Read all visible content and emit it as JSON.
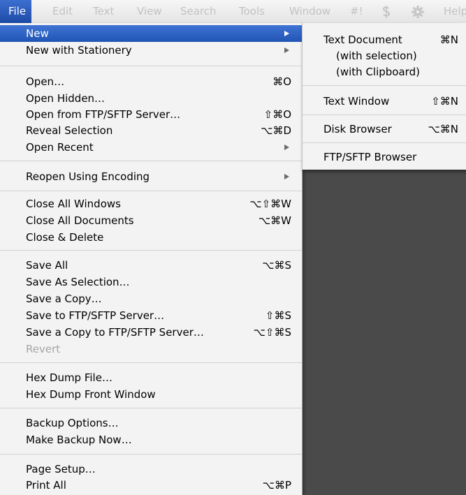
{
  "menubar": {
    "items": [
      "File",
      "Edit",
      "Text",
      "View",
      "Search",
      "Tools",
      "Window",
      "#!",
      "Help"
    ],
    "icons": [
      "dollar-scripts-icon",
      "gear-icon"
    ]
  },
  "file_menu": {
    "new": "New",
    "new_with_stationery": "New with Stationery",
    "open": {
      "label": "Open…",
      "shortcut": "⌘O"
    },
    "open_hidden": "Open Hidden…",
    "open_ftp": {
      "label": "Open from FTP/SFTP Server…",
      "shortcut": "⇧⌘O"
    },
    "reveal_selection": {
      "label": "Reveal Selection",
      "shortcut": "⌥⌘D"
    },
    "open_recent": "Open Recent",
    "reopen_encoding": "Reopen Using Encoding",
    "close_all_windows": {
      "label": "Close All Windows",
      "shortcut": "⌥⇧⌘W"
    },
    "close_all_documents": {
      "label": "Close All Documents",
      "shortcut": "⌥⌘W"
    },
    "close_delete": "Close & Delete",
    "save_all": {
      "label": "Save All",
      "shortcut": "⌥⌘S"
    },
    "save_as_selection": "Save As Selection…",
    "save_copy": "Save a Copy…",
    "save_ftp": {
      "label": "Save to FTP/SFTP Server…",
      "shortcut": "⇧⌘S"
    },
    "save_copy_ftp": {
      "label": "Save a Copy to FTP/SFTP Server…",
      "shortcut": "⌥⇧⌘S"
    },
    "revert": "Revert",
    "hex_dump_file": "Hex Dump File…",
    "hex_dump_front": "Hex Dump Front Window",
    "backup_options": "Backup Options…",
    "make_backup": "Make Backup Now…",
    "page_setup": "Page Setup…",
    "print_all": {
      "label": "Print All",
      "shortcut": "⌥⌘P"
    }
  },
  "new_submenu": {
    "text_document": {
      "label": "Text Document",
      "shortcut": "⌘N"
    },
    "with_selection": "(with selection)",
    "with_clipboard": "(with Clipboard)",
    "text_window": {
      "label": "Text Window",
      "shortcut": "⇧⌘N"
    },
    "disk_browser": {
      "label": "Disk Browser",
      "shortcut": "⌥⌘N"
    },
    "ftp_browser": "FTP/SFTP Browser"
  }
}
